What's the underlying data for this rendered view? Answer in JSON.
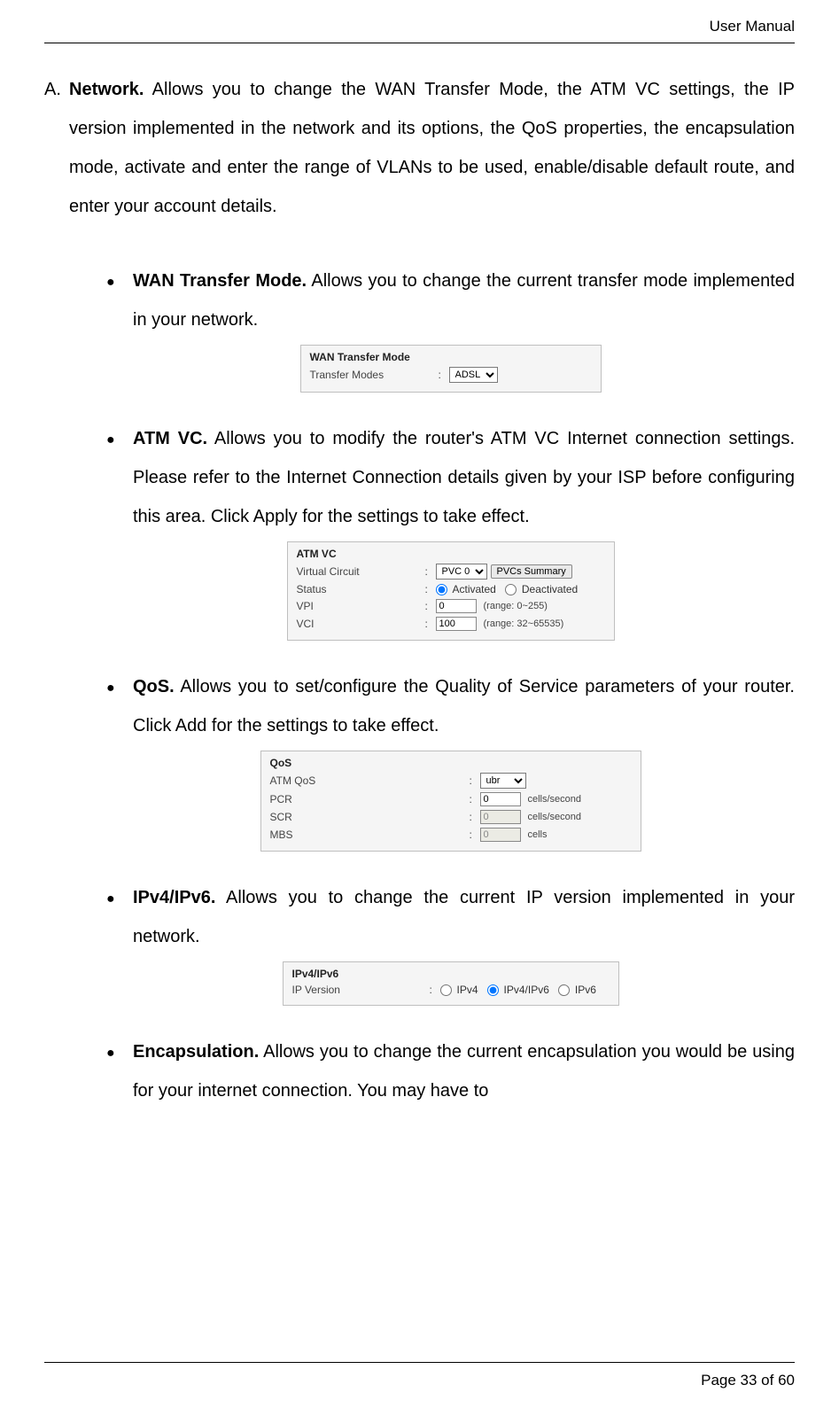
{
  "header": {
    "title": "User Manual"
  },
  "section_a": {
    "marker": "A.",
    "label": "Network.",
    "text": "  Allows  you  to  change  the  WAN  Transfer  Mode,  the  ATM  VC settings,  the  IP  version  implemented  in  the  network  and  its  options,  the QoS properties, the encapsulation mode,  activate and enter the range of  VLANs  to  be  used,  enable/disable  default  route,  and  enter  your account details."
  },
  "bullets": {
    "wan": {
      "label": "WAN  Transfer  Mode.",
      "text": "  Allows  you  to  change  the  current  transfer mode implemented in your network."
    },
    "atm": {
      "label": "ATM  VC.",
      "text": "  Allows  you  to  modify  the  router's  ATM  VC  Internet connection settings. Please refer to the Internet Connection details given by your ISP before configuring this area. Click Apply for the settings to take effect."
    },
    "qos": {
      "label": "QoS.",
      "text": " Allows you to set/configure the Quality of Service parameters of your router. Click Add for the settings to take effect."
    },
    "ipv": {
      "label": "IPv4/IPv6.",
      "text": "  Allows  you  to  change  the  current  IP  version implemented in your network."
    },
    "encap": {
      "label": "Encapsulation.",
      "text": "  Allows  you  to  change  the  current  encapsulation you would be using for your internet connection. You may have to"
    }
  },
  "ui": {
    "wan": {
      "title": "WAN Transfer Mode",
      "row_label": "Transfer Modes",
      "select_value": "ADSL"
    },
    "atm": {
      "title": "ATM VC",
      "vc_label": "Virtual Circuit",
      "vc_select": "PVC 0",
      "vc_button": "PVCs Summary",
      "status_label": "Status",
      "status_opt1": "Activated",
      "status_opt2": "Deactivated",
      "vpi_label": "VPI",
      "vpi_value": "0",
      "vpi_hint": "(range: 0~255)",
      "vci_label": "VCI",
      "vci_value": "100",
      "vci_hint": "(range: 32~65535)"
    },
    "qos": {
      "title": "QoS",
      "atmqos_label": "ATM QoS",
      "atmqos_value": "ubr",
      "pcr_label": "PCR",
      "pcr_value": "0",
      "pcr_unit": "cells/second",
      "scr_label": "SCR",
      "scr_value": "0",
      "scr_unit": "cells/second",
      "mbs_label": "MBS",
      "mbs_value": "0",
      "mbs_unit": "cells"
    },
    "ipv": {
      "title": "IPv4/IPv6",
      "row_label": "IP Version",
      "opt1": "IPv4",
      "opt2": "IPv4/IPv6",
      "opt3": "IPv6"
    }
  },
  "footer": {
    "page_left": "Page 33",
    "page_right": " of 60"
  }
}
